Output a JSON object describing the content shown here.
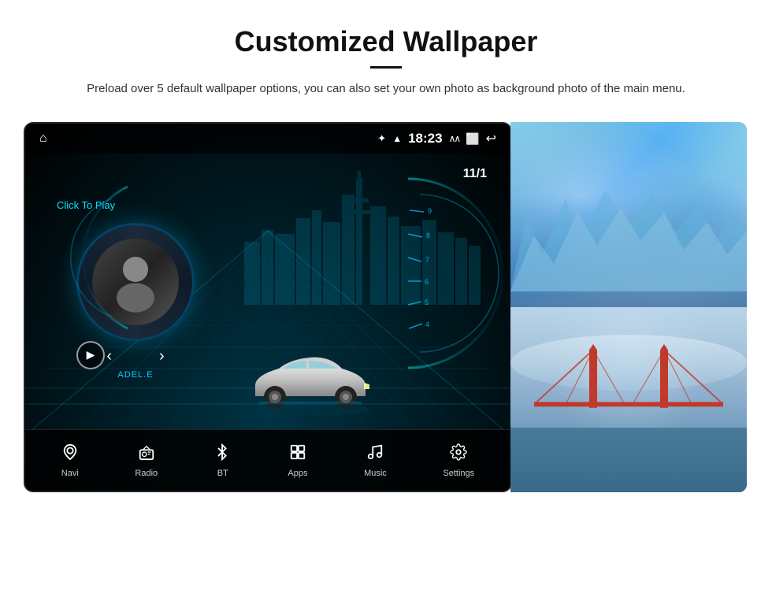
{
  "header": {
    "title": "Customized Wallpaper",
    "subtitle": "Preload over 5 default wallpaper options, you can also set your own photo as background photo of the main menu."
  },
  "screen": {
    "status_bar": {
      "home_icon": "⌂",
      "bluetooth_icon": "✦",
      "signal_icon": "▲",
      "time": "18:23",
      "expand_icon": "∧∧",
      "window_icon": "⬜",
      "back_icon": "↩"
    },
    "click_to_play": "Click To Play",
    "date": "11/1",
    "artist": "ADEL.E",
    "nav_items": [
      {
        "id": "navi",
        "label": "Navi",
        "icon": "◎"
      },
      {
        "id": "radio",
        "label": "Radio",
        "icon": "📻"
      },
      {
        "id": "bt",
        "label": "BT",
        "icon": "⚡"
      },
      {
        "id": "apps",
        "label": "Apps",
        "icon": "⊞"
      },
      {
        "id": "music",
        "label": "Music",
        "icon": "♪"
      },
      {
        "id": "settings",
        "label": "Settings",
        "icon": "⚙"
      }
    ]
  },
  "colors": {
    "accent_cyan": "#00e5ff",
    "screen_bg_dark": "#001a22",
    "nav_bg": "rgba(0,0,0,0.85)"
  }
}
